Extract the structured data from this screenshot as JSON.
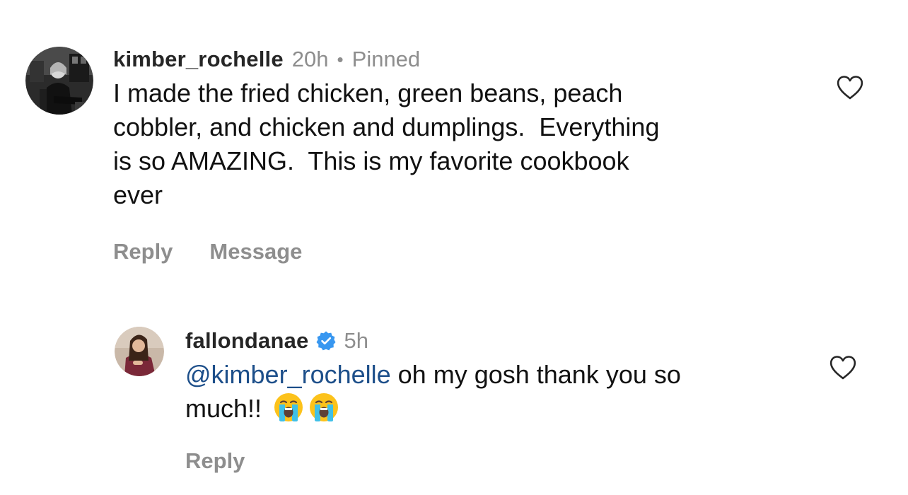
{
  "comments": [
    {
      "username": "kimber_rochelle",
      "time": "20h",
      "separator": "•",
      "pinned": "Pinned",
      "text_lines": [
        "I made the fried chicken, green beans, peach",
        "cobbler, and chicken and dumplings.  Everything",
        "is so AMAZING.  This is my favorite cookbook",
        "ever"
      ],
      "actions": {
        "reply": "Reply",
        "message": "Message"
      }
    },
    {
      "username": "fallondanae",
      "verified": true,
      "time": "5h",
      "mention": "@kimber_rochelle",
      "text_rest": " oh my gosh thank you so",
      "text_line2": "much!!",
      "emojis": [
        "loudly-crying-face",
        "loudly-crying-face"
      ],
      "actions": {
        "reply": "Reply"
      }
    }
  ],
  "colors": {
    "username": "#262626",
    "muted": "#8e8e8e",
    "mention": "#1d4f8a",
    "verified": "#3897f0"
  }
}
